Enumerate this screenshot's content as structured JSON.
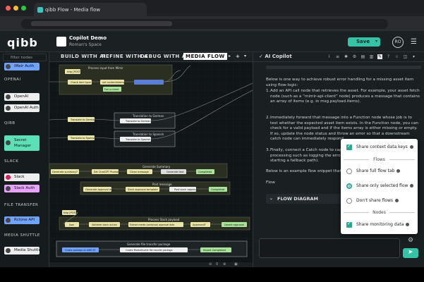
{
  "browser": {
    "tab_title": "qibb Flow - Media flow"
  },
  "header": {
    "logo": "qibb",
    "project_title": "Copilot Demo",
    "project_sub": "Roman's Space",
    "save_label": "Save",
    "avatar": "RO"
  },
  "palette": {
    "filter_placeholder": "filter nodes",
    "nodes": {
      "iMeir": "iMeir Auth",
      "openai": "OpenAI",
      "openai_auth": "OpenAI Auth",
      "secret": "Secret Manager",
      "slack": "Slack",
      "slack_auth": "Slack Auth",
      "rclone": "Rclone API",
      "media_shuttle": "Media Shuttle"
    },
    "sections": {
      "openai": "OPENAI",
      "qibb": "QIBB",
      "slack": "SLACK",
      "file": "FILE TRANSFER",
      "media": "MEDIA SHUTTLE"
    }
  },
  "canvas": {
    "tabs": [
      "BUILD WITH AI",
      "REFINE WITH A",
      "DEBUG WITH AI",
      "MEDIA FLOW"
    ],
    "groups": {
      "g1": "Process input from Mimir",
      "g2": "Translation to German",
      "g3": "Translation to Spanish",
      "g4": "Generate Summary",
      "g5": "Post message",
      "g6": "Process Slack payload",
      "g7": "Generate file transfer package"
    },
    "nodes": {
      "http1": "http [POST]",
      "check": "Check item type",
      "set_content": "set contentIstemp",
      "fail": "Fail o-m/ext",
      "de_a": "Translate to German",
      "de_b": "Translate to German",
      "es_a": "Translate to Spanish",
      "es_b": "Translate to Spanish",
      "sum": "Generate summary?",
      "chat": "Set ChatGPT Prompt",
      "fmsg": "Clean message",
      "genai": "Generate text",
      "done1": "Completed",
      "prep": "Generate approval data",
      "approval": "Slack approval template",
      "post": "Post slack approval",
      "done2": "Completed",
      "http2": "http [POST]",
      "json": "json",
      "validate": "Validate slack action",
      "extract": "Extract media (send/use) approval data",
      "approved": "Approved?",
      "upd": "Upsert approval",
      "ms": "Create package on AWS S3",
      "mft": "Create MediaShuttle file transfer package",
      "import": "Import Completed"
    },
    "zoom": "0"
  },
  "ai": {
    "title": "AI Copilot",
    "intro": "Below is one way to achieve robust error handling for a missing asset item using flow-logic:",
    "steps": [
      "Add an API call node that retrieves the asset. For example, your asset fetch node (such as a “mimir-api-client” node) produces a message that contains an array of items (e.g. in msg.payload.items).",
      "Immediately forward that message into a Function node whose job is to test whether the expected asset item exists. In the Function node, you can check for a valid payload and if the items array is either missing or empty. If so, update the node status and throw an error so that a downstream catch node can immediately respond.",
      "Finally, connect a Catch node to cap processing such as logging the error starting a fallback path)."
    ],
    "outro": "Below is an example flow snippet that de",
    "flow_label": "Flow",
    "flow_diagram": "FLOW DIAGRAM"
  },
  "popup": {
    "context": "Share context data keys",
    "flows_header": "Flows",
    "full_flow": "Share full flow tab",
    "selected_flow": "Share only selected flow",
    "no_flows": "Don't share flows",
    "nodes_header": "Nodes",
    "monitoring": "Share monitoring data"
  },
  "colors": {
    "accent": "#35c3a7"
  }
}
